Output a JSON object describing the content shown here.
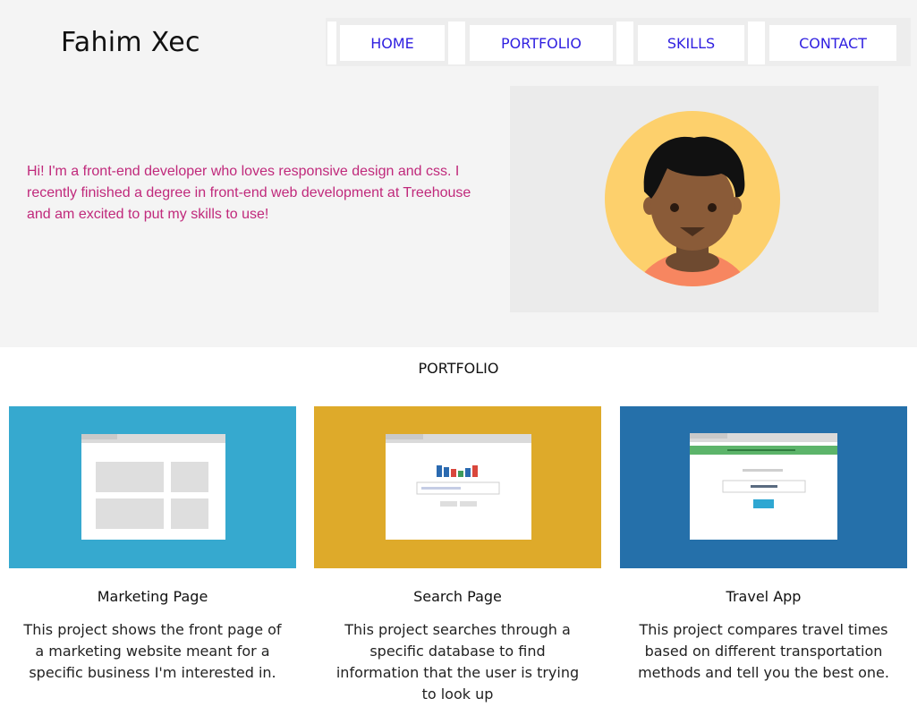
{
  "header": {
    "brand": "Fahim Xec",
    "nav": [
      {
        "label": "HOME"
      },
      {
        "label": "PORTFOLIO"
      },
      {
        "label": "SKILLS"
      },
      {
        "label": "CONTACT"
      }
    ]
  },
  "hero": {
    "intro": "Hi! I'm a front-end developer who loves responsive design and css. I recently finished a degree in front-end web development at Treehouse and am excited to put my skills to use!"
  },
  "portfolio": {
    "title": "PORTFOLIO",
    "projects": [
      {
        "title": "Marketing Page",
        "description": "This project shows the front page of a marketing website meant for a specific business I'm interested in.",
        "thumb_color": "#36a9cf"
      },
      {
        "title": "Search Page",
        "description": "This project searches through a specific database to find information that the user is trying to look up",
        "thumb_color": "#deaa2a"
      },
      {
        "title": "Travel App",
        "description": "This project compares travel times based on different transportation methods and tell you the best one.",
        "thumb_color": "#2570aa"
      }
    ]
  },
  "colors": {
    "nav_link": "#2f1fe0",
    "intro_text": "#c0297b",
    "hero_bg": "#f4f4f4"
  }
}
